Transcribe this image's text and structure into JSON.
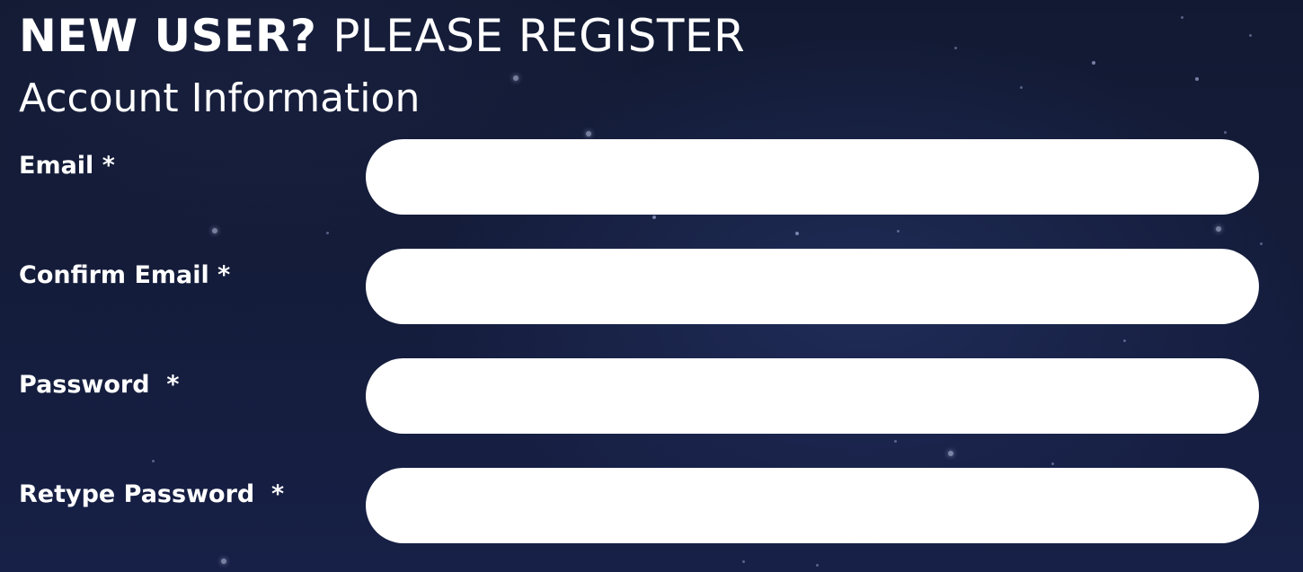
{
  "header": {
    "title_strong": "NEW USER?",
    "title_light": "PLEASE REGISTER"
  },
  "section": {
    "title": "Account Information"
  },
  "fields": [
    {
      "label": "Email *",
      "value": "",
      "type": "email"
    },
    {
      "label": "Confirm Email *",
      "value": "",
      "type": "email"
    },
    {
      "label": "Password  *",
      "value": "",
      "type": "password"
    },
    {
      "label": "Retype Password  *",
      "value": "",
      "type": "password"
    }
  ],
  "colors": {
    "background": "#141c3a",
    "text": "#ffffff",
    "field": "#ffffff"
  }
}
